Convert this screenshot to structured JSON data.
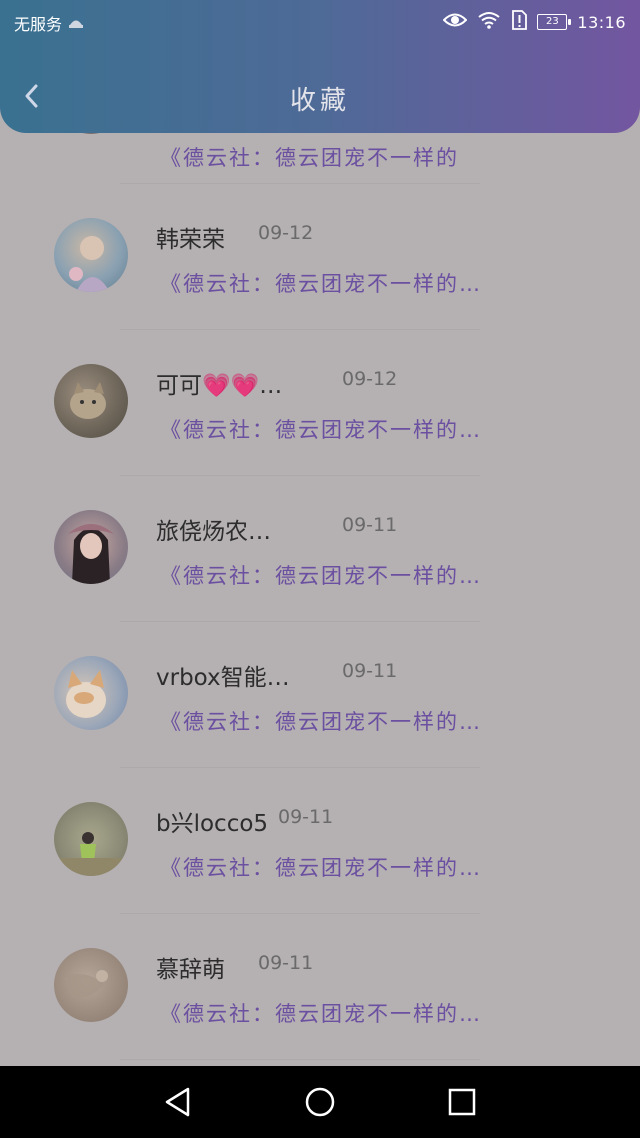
{
  "status_bar": {
    "carrier": "无服务",
    "time": "13:16",
    "battery": "23"
  },
  "header": {
    "title": "收藏"
  },
  "partial_item": {
    "snippet": "《德云社：德云团宠不一样的"
  },
  "items": [
    {
      "name": "韩荣荣",
      "date": "09-12",
      "snippet": "《德云社：德云团宠不一样的…"
    },
    {
      "name": "可可💗💗…",
      "date": "09-12",
      "snippet": "《德云社：德云团宠不一样的…"
    },
    {
      "name": "旅侥炀农…",
      "date": "09-11",
      "snippet": "《德云社：德云团宠不一样的…"
    },
    {
      "name": "vrbox智能…",
      "date": "09-11",
      "snippet": "《德云社：德云团宠不一样的…"
    },
    {
      "name": "b兴locco5",
      "date": "09-11",
      "snippet": "《德云社：德云团宠不一样的…"
    },
    {
      "name": "慕辞萌",
      "date": "09-11",
      "snippet": "《德云社：德云团宠不一样的…"
    }
  ],
  "icons": {
    "back": "chevron-left-icon",
    "eye": "eye-icon",
    "wifi": "wifi-icon",
    "alert": "sim-alert-icon",
    "battery": "battery-icon",
    "nav_back": "triangle-back-icon",
    "nav_home": "circle-home-icon",
    "nav_recent": "square-recent-icon"
  },
  "colors": {
    "header_start": "#3a7190",
    "header_end": "#7356a0",
    "snippet": "#6b4fa0",
    "background": "#b5b0b2"
  }
}
